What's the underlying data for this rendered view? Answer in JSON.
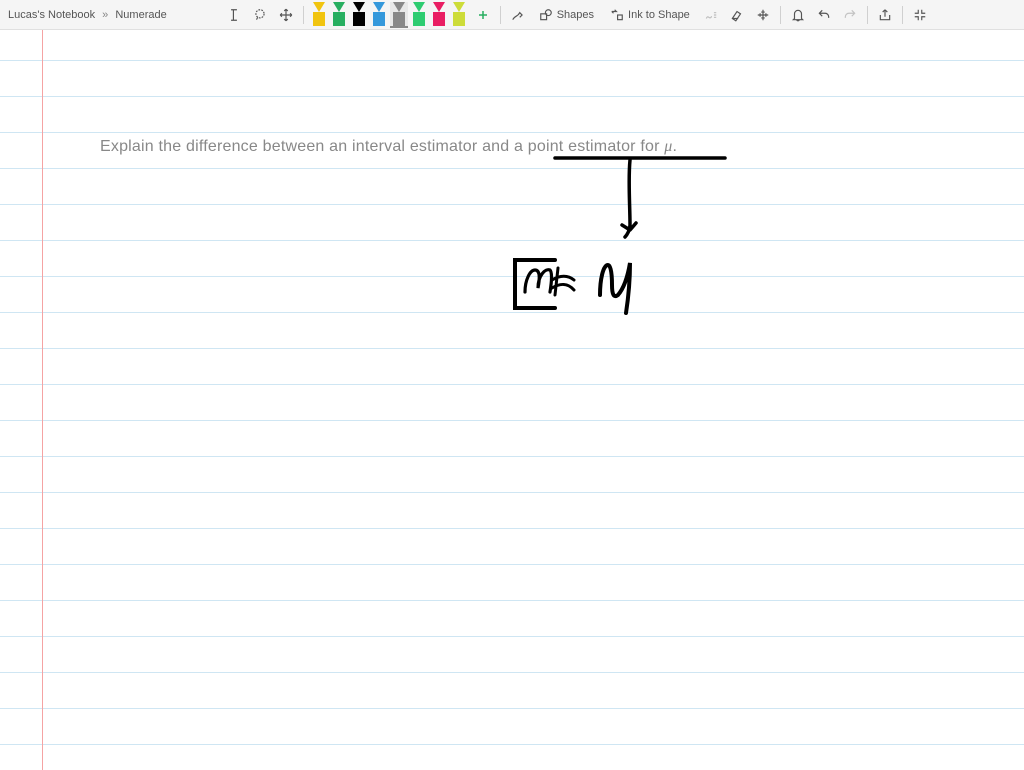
{
  "breadcrumb": {
    "notebook": "Lucas's Notebook",
    "page": "Numerade"
  },
  "toolbar": {
    "shapes_label": "Shapes",
    "ink_to_shape_label": "Ink to Shape"
  },
  "pens": [
    {
      "color": "#f1c40f"
    },
    {
      "color": "#27ae60"
    },
    {
      "color": "#000000"
    },
    {
      "color": "#3498db"
    },
    {
      "color": "#888888"
    },
    {
      "color": "#2ecc71"
    },
    {
      "color": "#e91e63"
    },
    {
      "color": "#cddc39"
    }
  ],
  "selected_pen_index": 4,
  "content": {
    "question": "Explain the difference between an interval estimator and a point estimator for",
    "symbol": "μ",
    "period": "."
  },
  "ink": {
    "handwriting_label_1": "m≈",
    "handwriting_label_2": "μ"
  }
}
